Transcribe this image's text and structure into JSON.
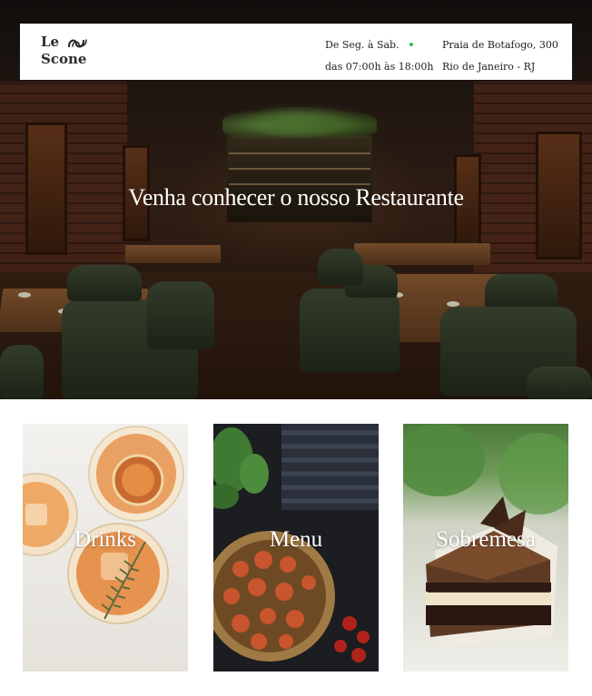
{
  "header": {
    "logo_line1": "Le",
    "logo_line2": "Scone",
    "hours_days": "De Seg. à Sab.",
    "hours_time": "das 07:00h às 18:00h",
    "address_line1": "Praia de Botafogo, 300",
    "address_line2": "Rio de Janeiro - RJ",
    "status_color": "#2ec24a"
  },
  "hero": {
    "title": "Venha conhecer o nosso Restaurante"
  },
  "cards": [
    {
      "label": "Drinks"
    },
    {
      "label": "Menu"
    },
    {
      "label": "Sobremesa"
    }
  ]
}
